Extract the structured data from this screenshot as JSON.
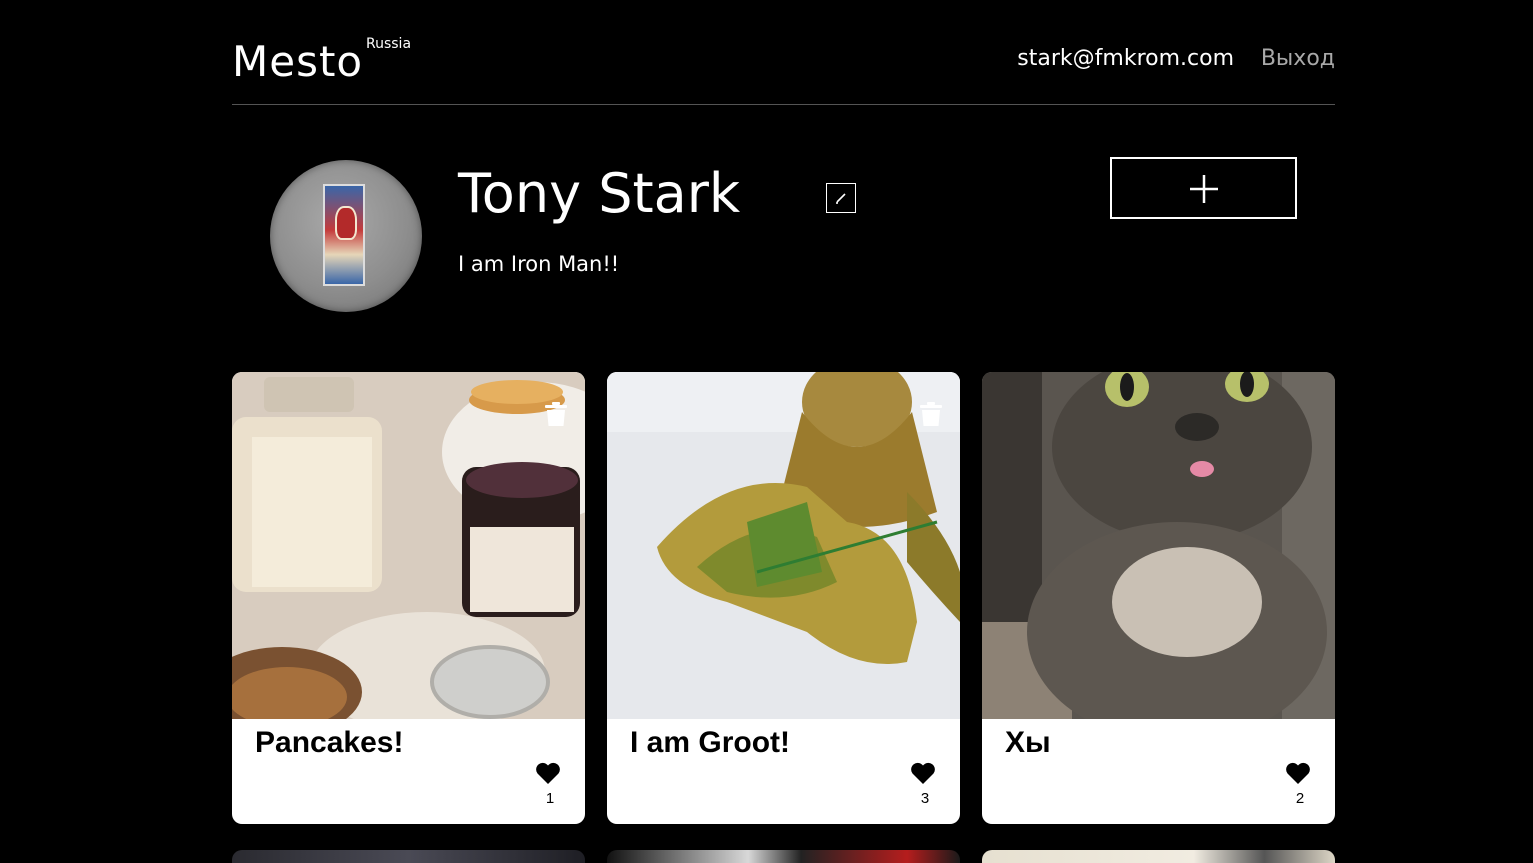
{
  "header": {
    "logo": "Mesto",
    "logo_superscript": "Russia",
    "email": "stark@fmkrom.com",
    "logout": "Выход"
  },
  "profile": {
    "name": "Tony Stark",
    "about": "I am Iron Man!!"
  },
  "cards": [
    {
      "title": "Pancakes!",
      "likes": "1",
      "deletable": true
    },
    {
      "title": "I am Groot!",
      "likes": "3",
      "deletable": true
    },
    {
      "title": "Хы",
      "likes": "2",
      "deletable": false
    }
  ],
  "icons": {
    "edit": "pencil-icon",
    "add": "plus-icon",
    "delete": "trash-icon",
    "like": "heart-icon"
  },
  "colors": {
    "background": "#000000",
    "card": "#ffffff",
    "header_border": "#545454",
    "logout": "#a9a9a9"
  }
}
